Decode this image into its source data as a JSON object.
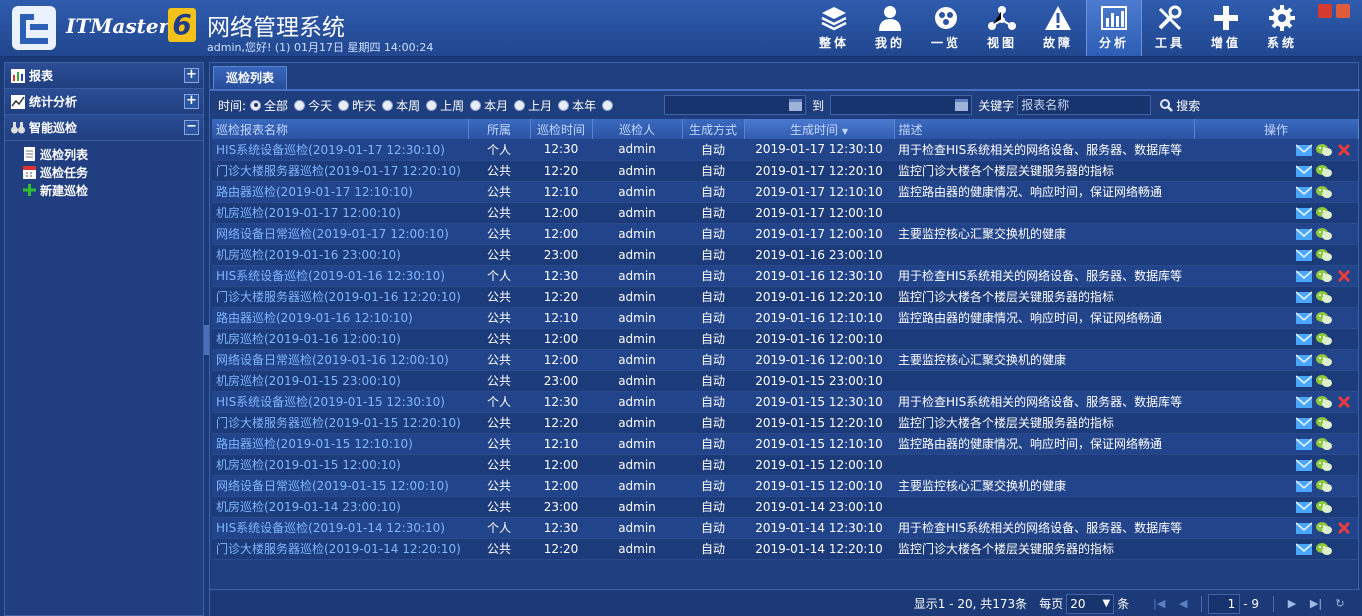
{
  "header": {
    "brand": "ITMaster",
    "brand_version": "6",
    "system_title": "网络管理系统",
    "welcome": "admin,您好! (1) 01月17日 星期四 14:00:24"
  },
  "nav": [
    {
      "label": "整体",
      "icon": "layers-icon"
    },
    {
      "label": "我的",
      "icon": "user-icon"
    },
    {
      "label": "一览",
      "icon": "overview-icon"
    },
    {
      "label": "视图",
      "icon": "topology-icon"
    },
    {
      "label": "故障",
      "icon": "warning-icon"
    },
    {
      "label": "分析",
      "icon": "chart-icon",
      "active": true
    },
    {
      "label": "工具",
      "icon": "tools-icon"
    },
    {
      "label": "增值",
      "icon": "plus-icon"
    },
    {
      "label": "系统",
      "icon": "gear-icon"
    }
  ],
  "sidebar": {
    "sections": [
      {
        "label": "报表",
        "toggle": "+"
      },
      {
        "label": "统计分析",
        "toggle": "+"
      },
      {
        "label": "智能巡检",
        "toggle": "−"
      }
    ],
    "items": [
      {
        "label": "巡检列表"
      },
      {
        "label": "巡检任务"
      },
      {
        "label": "新建巡检"
      }
    ]
  },
  "tab": {
    "label": "巡检列表"
  },
  "filter": {
    "time_label": "时间:",
    "options": [
      "全部",
      "今天",
      "昨天",
      "本周",
      "上周",
      "本月",
      "上月",
      "本年"
    ],
    "selected": "全部",
    "to_label": "到",
    "keyword_label": "关键字",
    "keyword_placeholder": "报表名称",
    "search_label": "搜索"
  },
  "table": {
    "columns": [
      "巡检报表名称",
      "所属",
      "巡检时间",
      "巡检人",
      "生成方式",
      "生成时间",
      "描述",
      "操作"
    ],
    "rows": [
      {
        "name": "HIS系统设备巡检(2019-01-17 12:30:10)",
        "owner": "个人",
        "time": "12:30",
        "user": "admin",
        "mode": "自动",
        "gen": "2019-01-17 12:30:10",
        "desc": "用于检查HIS系统相关的网络设备、服务器、数据库等",
        "del": true
      },
      {
        "name": "门诊大楼服务器巡检(2019-01-17 12:20:10)",
        "owner": "公共",
        "time": "12:20",
        "user": "admin",
        "mode": "自动",
        "gen": "2019-01-17 12:20:10",
        "desc": "监控门诊大楼各个楼层关键服务器的指标",
        "del": false
      },
      {
        "name": "路由器巡检(2019-01-17 12:10:10)",
        "owner": "公共",
        "time": "12:10",
        "user": "admin",
        "mode": "自动",
        "gen": "2019-01-17 12:10:10",
        "desc": "监控路由器的健康情况、响应时间，保证网络畅通",
        "del": false
      },
      {
        "name": "机房巡检(2019-01-17 12:00:10)",
        "owner": "公共",
        "time": "12:00",
        "user": "admin",
        "mode": "自动",
        "gen": "2019-01-17 12:00:10",
        "desc": "",
        "del": false
      },
      {
        "name": "网络设备日常巡检(2019-01-17 12:00:10)",
        "owner": "公共",
        "time": "12:00",
        "user": "admin",
        "mode": "自动",
        "gen": "2019-01-17 12:00:10",
        "desc": "主要监控核心汇聚交换机的健康",
        "del": false
      },
      {
        "name": "机房巡检(2019-01-16 23:00:10)",
        "owner": "公共",
        "time": "23:00",
        "user": "admin",
        "mode": "自动",
        "gen": "2019-01-16 23:00:10",
        "desc": "",
        "del": false
      },
      {
        "name": "HIS系统设备巡检(2019-01-16 12:30:10)",
        "owner": "个人",
        "time": "12:30",
        "user": "admin",
        "mode": "自动",
        "gen": "2019-01-16 12:30:10",
        "desc": "用于检查HIS系统相关的网络设备、服务器、数据库等",
        "del": true
      },
      {
        "name": "门诊大楼服务器巡检(2019-01-16 12:20:10)",
        "owner": "公共",
        "time": "12:20",
        "user": "admin",
        "mode": "自动",
        "gen": "2019-01-16 12:20:10",
        "desc": "监控门诊大楼各个楼层关键服务器的指标",
        "del": false
      },
      {
        "name": "路由器巡检(2019-01-16 12:10:10)",
        "owner": "公共",
        "time": "12:10",
        "user": "admin",
        "mode": "自动",
        "gen": "2019-01-16 12:10:10",
        "desc": "监控路由器的健康情况、响应时间，保证网络畅通",
        "del": false
      },
      {
        "name": "机房巡检(2019-01-16 12:00:10)",
        "owner": "公共",
        "time": "12:00",
        "user": "admin",
        "mode": "自动",
        "gen": "2019-01-16 12:00:10",
        "desc": "",
        "del": false
      },
      {
        "name": "网络设备日常巡检(2019-01-16 12:00:10)",
        "owner": "公共",
        "time": "12:00",
        "user": "admin",
        "mode": "自动",
        "gen": "2019-01-16 12:00:10",
        "desc": "主要监控核心汇聚交换机的健康",
        "del": false
      },
      {
        "name": "机房巡检(2019-01-15 23:00:10)",
        "owner": "公共",
        "time": "23:00",
        "user": "admin",
        "mode": "自动",
        "gen": "2019-01-15 23:00:10",
        "desc": "",
        "del": false
      },
      {
        "name": "HIS系统设备巡检(2019-01-15 12:30:10)",
        "owner": "个人",
        "time": "12:30",
        "user": "admin",
        "mode": "自动",
        "gen": "2019-01-15 12:30:10",
        "desc": "用于检查HIS系统相关的网络设备、服务器、数据库等",
        "del": true
      },
      {
        "name": "门诊大楼服务器巡检(2019-01-15 12:20:10)",
        "owner": "公共",
        "time": "12:20",
        "user": "admin",
        "mode": "自动",
        "gen": "2019-01-15 12:20:10",
        "desc": "监控门诊大楼各个楼层关键服务器的指标",
        "del": false
      },
      {
        "name": "路由器巡检(2019-01-15 12:10:10)",
        "owner": "公共",
        "time": "12:10",
        "user": "admin",
        "mode": "自动",
        "gen": "2019-01-15 12:10:10",
        "desc": "监控路由器的健康情况、响应时间，保证网络畅通",
        "del": false
      },
      {
        "name": "机房巡检(2019-01-15 12:00:10)",
        "owner": "公共",
        "time": "12:00",
        "user": "admin",
        "mode": "自动",
        "gen": "2019-01-15 12:00:10",
        "desc": "",
        "del": false
      },
      {
        "name": "网络设备日常巡检(2019-01-15 12:00:10)",
        "owner": "公共",
        "time": "12:00",
        "user": "admin",
        "mode": "自动",
        "gen": "2019-01-15 12:00:10",
        "desc": "主要监控核心汇聚交换机的健康",
        "del": false
      },
      {
        "name": "机房巡检(2019-01-14 23:00:10)",
        "owner": "公共",
        "time": "23:00",
        "user": "admin",
        "mode": "自动",
        "gen": "2019-01-14 23:00:10",
        "desc": "",
        "del": false
      },
      {
        "name": "HIS系统设备巡检(2019-01-14 12:30:10)",
        "owner": "个人",
        "time": "12:30",
        "user": "admin",
        "mode": "自动",
        "gen": "2019-01-14 12:30:10",
        "desc": "用于检查HIS系统相关的网络设备、服务器、数据库等",
        "del": true
      },
      {
        "name": "门诊大楼服务器巡检(2019-01-14 12:20:10)",
        "owner": "公共",
        "time": "12:20",
        "user": "admin",
        "mode": "自动",
        "gen": "2019-01-14 12:20:10",
        "desc": "监控门诊大楼各个楼层关键服务器的指标",
        "del": false
      }
    ]
  },
  "pager": {
    "summary": "显示1 - 20, 共173条",
    "per_page_label": "每页",
    "per_page": "20",
    "unit": "条",
    "page": "1",
    "total_pages": "- 9"
  },
  "colors": {
    "accent": "#2c5eb5",
    "link": "#7fb6ff",
    "background": "#1b3a78"
  }
}
